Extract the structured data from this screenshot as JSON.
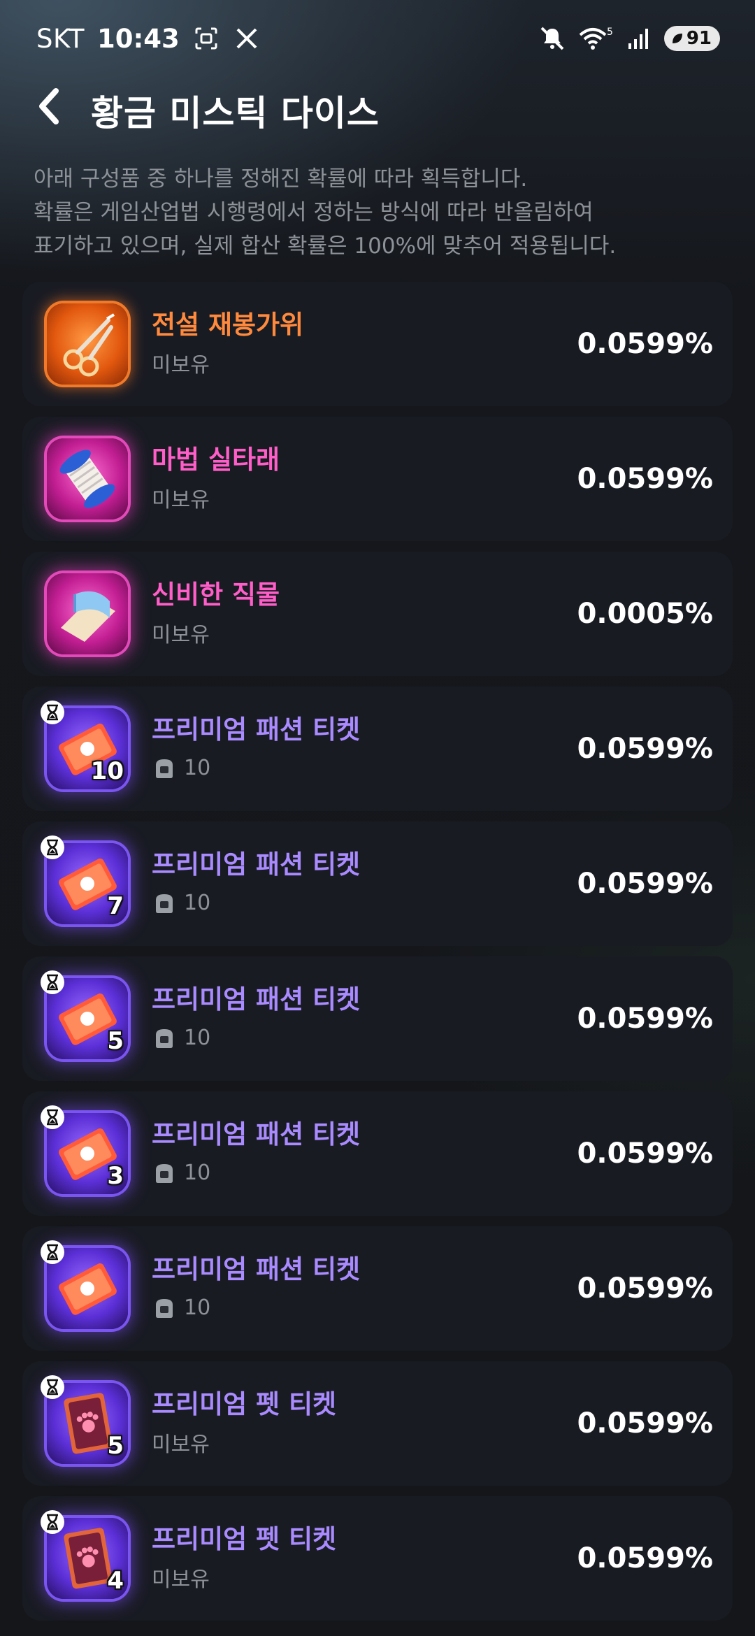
{
  "status_bar": {
    "carrier": "SKT",
    "time": "10:43",
    "battery": "91",
    "wifi_badge": "5"
  },
  "header": {
    "title": "황금 미스틱 다이스"
  },
  "notice": {
    "lines": [
      "아래 구성품 중 하나를 정해진 확률에 따라 획득합니다.",
      "확률은 게임산업법 시행령에서 정하는 방식에 따라 반올림하여",
      "표기하고 있으며, 실제 합산 확률은 100%에 맞추어 적용됩니다."
    ]
  },
  "items": [
    {
      "name": "전설 재봉가위",
      "status": "미보유",
      "probability": "0.0599%",
      "rarity": "orange",
      "icon": "scissors-icon"
    },
    {
      "name": "마법 실타래",
      "status": "미보유",
      "probability": "0.0599%",
      "rarity": "pink",
      "icon": "thread-spool-icon"
    },
    {
      "name": "신비한 직물",
      "status": "미보유",
      "probability": "0.0005%",
      "rarity": "pink",
      "icon": "fabric-icon"
    },
    {
      "name": "프리미엄 패션 티켓",
      "status": "10",
      "probability": "0.0599%",
      "rarity": "purple",
      "icon": "fashion-ticket-icon",
      "qty": "10",
      "timed": true,
      "owned_icon": true
    },
    {
      "name": "프리미엄 패션 티켓",
      "status": "10",
      "probability": "0.0599%",
      "rarity": "purple",
      "icon": "fashion-ticket-icon",
      "qty": "7",
      "timed": true,
      "owned_icon": true
    },
    {
      "name": "프리미엄 패션 티켓",
      "status": "10",
      "probability": "0.0599%",
      "rarity": "purple",
      "icon": "fashion-ticket-icon",
      "qty": "5",
      "timed": true,
      "owned_icon": true
    },
    {
      "name": "프리미엄 패션 티켓",
      "status": "10",
      "probability": "0.0599%",
      "rarity": "purple",
      "icon": "fashion-ticket-icon",
      "qty": "3",
      "timed": true,
      "owned_icon": true
    },
    {
      "name": "프리미엄 패션 티켓",
      "status": "10",
      "probability": "0.0599%",
      "rarity": "purple",
      "icon": "fashion-ticket-icon",
      "qty": "",
      "timed": true,
      "owned_icon": true
    },
    {
      "name": "프리미엄 펫 티켓",
      "status": "미보유",
      "probability": "0.0599%",
      "rarity": "purple",
      "icon": "pet-ticket-icon",
      "qty": "5",
      "timed": true
    },
    {
      "name": "프리미엄 펫 티켓",
      "status": "미보유",
      "probability": "0.0599%",
      "rarity": "purple",
      "icon": "pet-ticket-icon",
      "qty": "4",
      "timed": true
    }
  ],
  "colors": {
    "legendary": "#ff8a3d",
    "epic": "#ff5ec8",
    "rare": "#a98bff"
  }
}
